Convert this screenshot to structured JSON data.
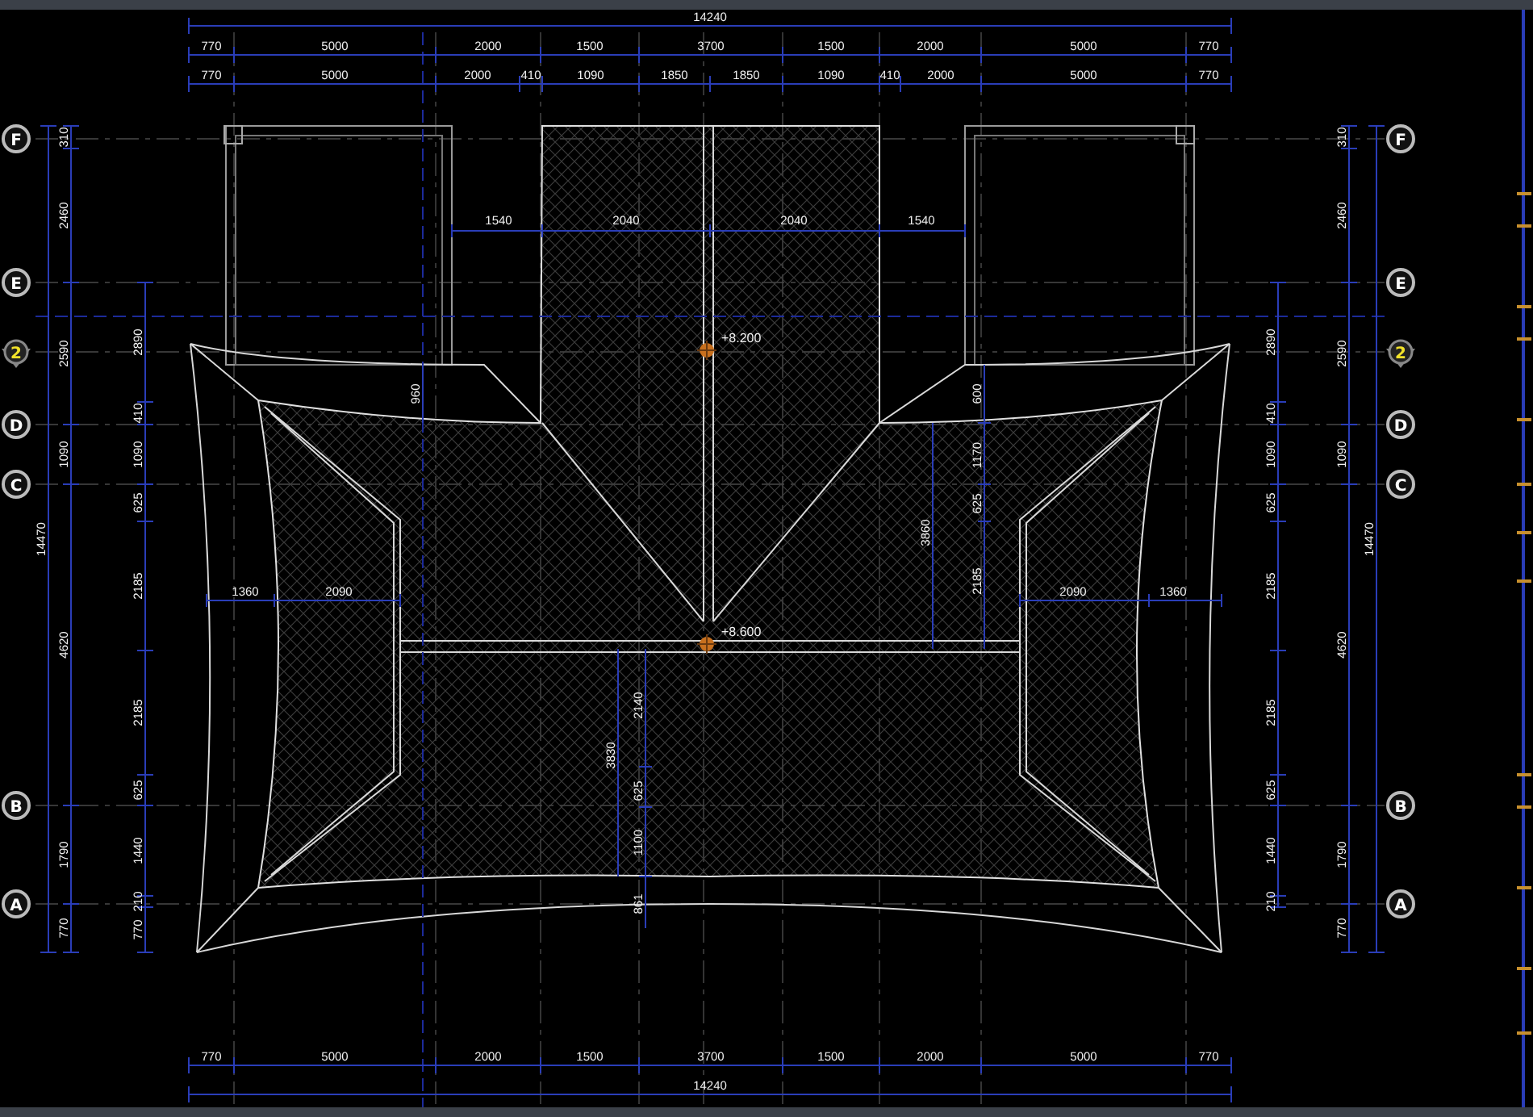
{
  "axes_left": [
    {
      "label": "F",
      "kind": "grid"
    },
    {
      "label": "E",
      "kind": "grid"
    },
    {
      "label": "2",
      "kind": "section"
    },
    {
      "label": "D",
      "kind": "grid"
    },
    {
      "label": "C",
      "kind": "grid"
    },
    {
      "label": "B",
      "kind": "grid"
    },
    {
      "label": "A",
      "kind": "grid"
    }
  ],
  "axes_right": [
    {
      "label": "F",
      "kind": "grid"
    },
    {
      "label": "E",
      "kind": "grid"
    },
    {
      "label": "2",
      "kind": "section"
    },
    {
      "label": "D",
      "kind": "grid"
    },
    {
      "label": "C",
      "kind": "grid"
    },
    {
      "label": "B",
      "kind": "grid"
    },
    {
      "label": "A",
      "kind": "grid"
    }
  ],
  "dimensions": {
    "top_total": [
      "14240"
    ],
    "top_1": [
      "770",
      "5000",
      "2000",
      "1500",
      "3700",
      "1500",
      "2000",
      "5000",
      "770"
    ],
    "top_2": [
      "770",
      "5000",
      "2000",
      "410",
      "1090",
      "1850",
      "1850",
      "1090",
      "410",
      "2000",
      "5000",
      "770"
    ],
    "bottom_1": [
      "770",
      "5000",
      "2000",
      "1500",
      "3700",
      "1500",
      "2000",
      "5000",
      "770"
    ],
    "bottom_total": [
      "14240"
    ],
    "left_total": [
      "14470"
    ],
    "left_outer": [
      "310",
      "2460",
      "2590",
      "1090",
      "4620",
      "1790",
      "770"
    ],
    "left_inner": [
      "2890",
      "410",
      "1090",
      "625",
      "2185",
      "2185",
      "625",
      "1440",
      "210",
      "770"
    ],
    "right_inner": [
      "2890",
      "410",
      "1090",
      "625",
      "2185",
      "2185",
      "625",
      "1440",
      "210"
    ],
    "right_outer": [
      "310",
      "2460",
      "2590",
      "1090",
      "4620",
      "1790",
      "770"
    ],
    "right_total": [
      "14470"
    ]
  },
  "roof_dimensions": [
    "1540",
    "2040",
    "2040",
    "1540",
    "960",
    "600",
    "1170",
    "625",
    "2185",
    "3860",
    "1360",
    "2090",
    "2090",
    "1360",
    "3830",
    "2140",
    "625",
    "1100",
    "861"
  ],
  "elevation_marks": [
    {
      "text": "+8.200"
    },
    {
      "text": "+8.600"
    }
  ]
}
